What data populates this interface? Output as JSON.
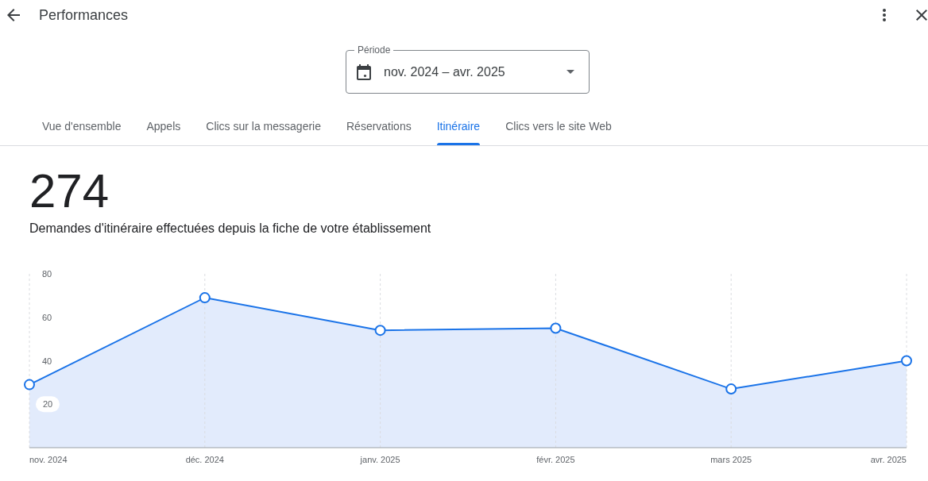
{
  "header": {
    "title": "Performances"
  },
  "period": {
    "label": "Période",
    "value": "nov. 2024 – avr. 2025"
  },
  "tabs": [
    {
      "label": "Vue d'ensemble",
      "selected": false
    },
    {
      "label": "Appels",
      "selected": false
    },
    {
      "label": "Clics sur la messagerie",
      "selected": false
    },
    {
      "label": "Réservations",
      "selected": false
    },
    {
      "label": "Itinéraire",
      "selected": true
    },
    {
      "label": "Clics vers le site Web",
      "selected": false
    }
  ],
  "performance": {
    "total": "274",
    "description": "Demandes d'itinéraire effectuées depuis la fiche de votre établissement",
    "chart_data": {
      "type": "area",
      "categories": [
        "nov. 2024",
        "déc. 2024",
        "janv. 2025",
        "févr. 2025",
        "mars 2025",
        "avr. 2025"
      ],
      "series": [
        {
          "color": "#1a73e8",
          "values": [
            29,
            69,
            54,
            55,
            27,
            40
          ]
        }
      ],
      "ylim": [
        0,
        80
      ],
      "yticks": [
        20,
        40,
        60,
        80
      ],
      "grid": "vertical"
    }
  }
}
